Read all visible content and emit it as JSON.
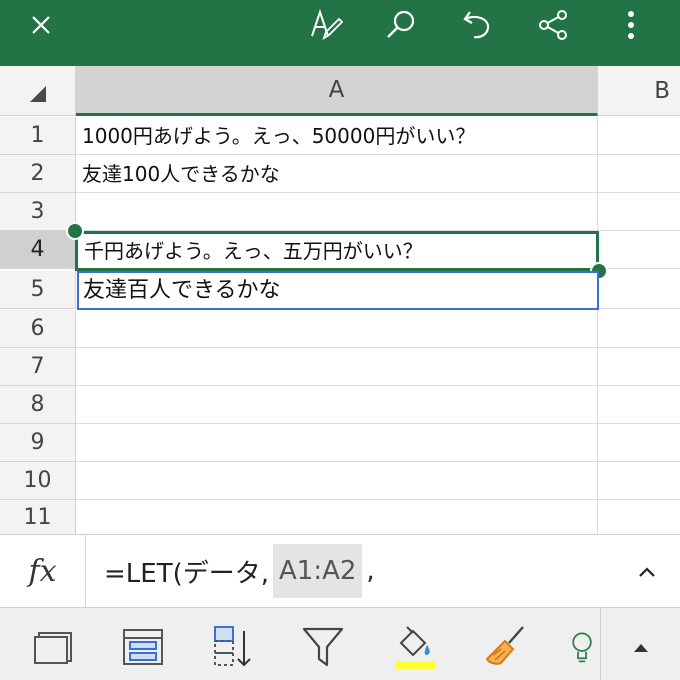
{
  "toolbar": {
    "icons": [
      "close-icon",
      "edit-icon",
      "search-icon",
      "undo-icon",
      "share-icon",
      "more-icon"
    ],
    "accent": "#227447"
  },
  "grid": {
    "columns": [
      "A",
      "B"
    ],
    "selected_column": "A",
    "rows": [
      {
        "num": "1",
        "a": "1000円あげよう。えっ、50000円がいい？"
      },
      {
        "num": "2",
        "a": "友達100人できるかな"
      },
      {
        "num": "3",
        "a": ""
      },
      {
        "num": "4",
        "a": "千円あげよう。えっ、五万円がいい？"
      },
      {
        "num": "5",
        "a": "友達百人できるかな"
      },
      {
        "num": "6",
        "a": ""
      },
      {
        "num": "7",
        "a": ""
      },
      {
        "num": "8",
        "a": ""
      },
      {
        "num": "9",
        "a": ""
      },
      {
        "num": "10",
        "a": ""
      },
      {
        "num": "11",
        "a": ""
      }
    ],
    "selected_row": "4"
  },
  "formula_bar": {
    "fx_label": "fx",
    "text_before": "=LET(データ,",
    "ref": "A1:A2",
    "text_after": ","
  },
  "bottom_toolbar": {
    "icons": [
      "freeze-panes-icon",
      "format-cells-icon",
      "sort-icon",
      "filter-icon",
      "fill-color-icon",
      "clear-format-icon",
      "idea-icon",
      "expand-up-icon"
    ],
    "fill_color": "#ffff00"
  }
}
